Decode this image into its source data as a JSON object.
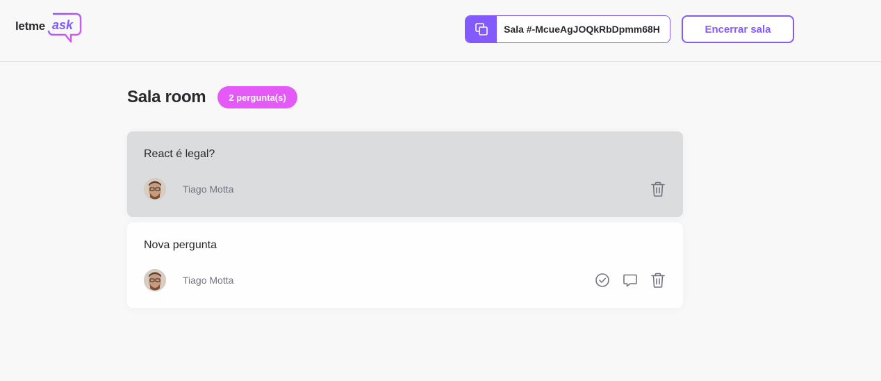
{
  "header": {
    "logo": {
      "text_main": "letme",
      "text_accent": "ask"
    },
    "room_code": {
      "label": "Sala #-McueAgJOQkRbDpmm68H",
      "icon": "copy-icon"
    },
    "close_button_label": "Encerrar sala"
  },
  "room": {
    "title": "Sala room",
    "question_count": "2 pergunta(s)"
  },
  "questions": [
    {
      "content": "React é legal?",
      "author": "Tiago Motta",
      "answered": true,
      "actions": [
        "trash-icon"
      ]
    },
    {
      "content": "Nova pergunta",
      "author": "Tiago Motta",
      "answered": false,
      "actions": [
        "check-circle-icon",
        "answer-icon",
        "trash-icon"
      ]
    }
  ],
  "colors": {
    "primary": "#835afd",
    "badge": "#e559f9",
    "answered_bg": "#dbdcdd",
    "card_bg": "#fefefe",
    "page_bg": "#f8f8f8"
  }
}
